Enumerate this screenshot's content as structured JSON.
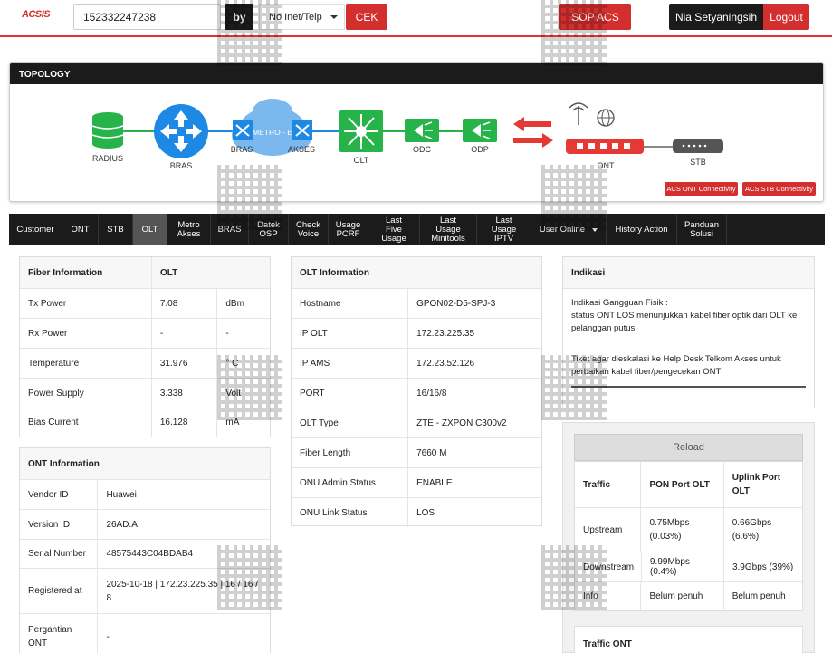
{
  "header": {
    "logo": "ACSIS",
    "search_value": "152332247238",
    "by_label": "by",
    "search_type": "No Inet/Telp",
    "cek_label": "CEK",
    "sop_label": "SOP ACS",
    "user_name": "Nia Setyaningsih",
    "logout_label": "Logout"
  },
  "topology": {
    "title": "TOPOLOGY",
    "nodes": {
      "radius": "RADIUS",
      "bras": "BRAS",
      "bras2": "BRAS",
      "metro": "METRO - E",
      "akses": "AKSES",
      "olt": "OLT",
      "odc": "ODC",
      "odp": "ODP",
      "ont": "ONT",
      "stb": "STB"
    },
    "acs_ont_label": "ACS ONT Connectivity",
    "acs_stb_label": "ACS STB Connectivity",
    "colors": {
      "green": "#26b34a",
      "blue": "#1e88e5",
      "red": "#e53935",
      "cloud": "#7ab8ee"
    }
  },
  "tabs": [
    {
      "label": "Customer"
    },
    {
      "label": "ONT"
    },
    {
      "label": "STB"
    },
    {
      "label": "OLT"
    },
    {
      "label": "Metro Akses"
    },
    {
      "label": "BRAS"
    },
    {
      "label": "Datek OSP"
    },
    {
      "label": "Check Voice"
    },
    {
      "label": "Usage PCRF"
    },
    {
      "label": "Last Five Usage"
    },
    {
      "label": "Last Usage Minitools"
    },
    {
      "label": "Last Usage IPTV"
    },
    {
      "label": "User Online"
    },
    {
      "label": "History Action"
    },
    {
      "label": "Panduan Solusi"
    }
  ],
  "fiber": {
    "header": [
      "Fiber Information",
      "OLT"
    ],
    "rows": [
      [
        "Tx Power",
        "7.08",
        "dBm"
      ],
      [
        "Rx Power",
        "-",
        "-"
      ],
      [
        "Temperature",
        "31.976",
        "° C"
      ],
      [
        "Power Supply",
        "3.338",
        "Volt"
      ],
      [
        "Bias Current",
        "16.128",
        "mA"
      ]
    ]
  },
  "ont_info": {
    "header": "ONT Information",
    "rows": [
      [
        "Vendor ID",
        "Huawei"
      ],
      [
        "Version ID",
        "26AD.A"
      ],
      [
        "Serial Number",
        "48575443C04BDAB4"
      ],
      [
        "Registered at",
        "2025-10-18 | 172.23.225.35 | 16 / 16 / 8"
      ],
      [
        "Pergantian ONT",
        "-"
      ]
    ]
  },
  "olt_info": {
    "header": "OLT Information",
    "rows": [
      [
        "Hostname",
        "GPON02-D5-SPJ-3"
      ],
      [
        "IP OLT",
        "172.23.225.35"
      ],
      [
        "IP AMS",
        "172.23.52.126"
      ],
      [
        "PORT",
        "16/16/8"
      ],
      [
        "OLT Type",
        "ZTE - ZXPON C300v2"
      ],
      [
        "Fiber Length",
        "7660 M"
      ],
      [
        "ONU Admin Status",
        "ENABLE"
      ],
      [
        "ONU Link Status",
        "LOS"
      ]
    ]
  },
  "indikasi": {
    "header": "Indikasi",
    "line1": "Indikasi Gangguan Fisik :",
    "line2": "status ONT LOS menunjukkan kabel fiber optik dari OLT ke pelanggan putus",
    "line3": "Tiket agar dieskalasi ke Help Desk Telkom Akses untuk perbaikan kabel fiber/pengecekan ONT"
  },
  "traffic": {
    "reload_label": "Reload",
    "header": [
      "Traffic",
      "PON Port OLT",
      "Uplink Port OLT"
    ],
    "rows": [
      [
        "Upstream",
        "0.75Mbps (0.03%)",
        "0.66Gbps (6.6%)"
      ],
      [
        "Downstream",
        "9.99Mbps (0.4%)",
        "3.9Gbps (39%)"
      ],
      [
        "Info",
        "Belum penuh",
        "Belum penuh"
      ]
    ],
    "traffic_ont_label": "Traffic ONT"
  }
}
